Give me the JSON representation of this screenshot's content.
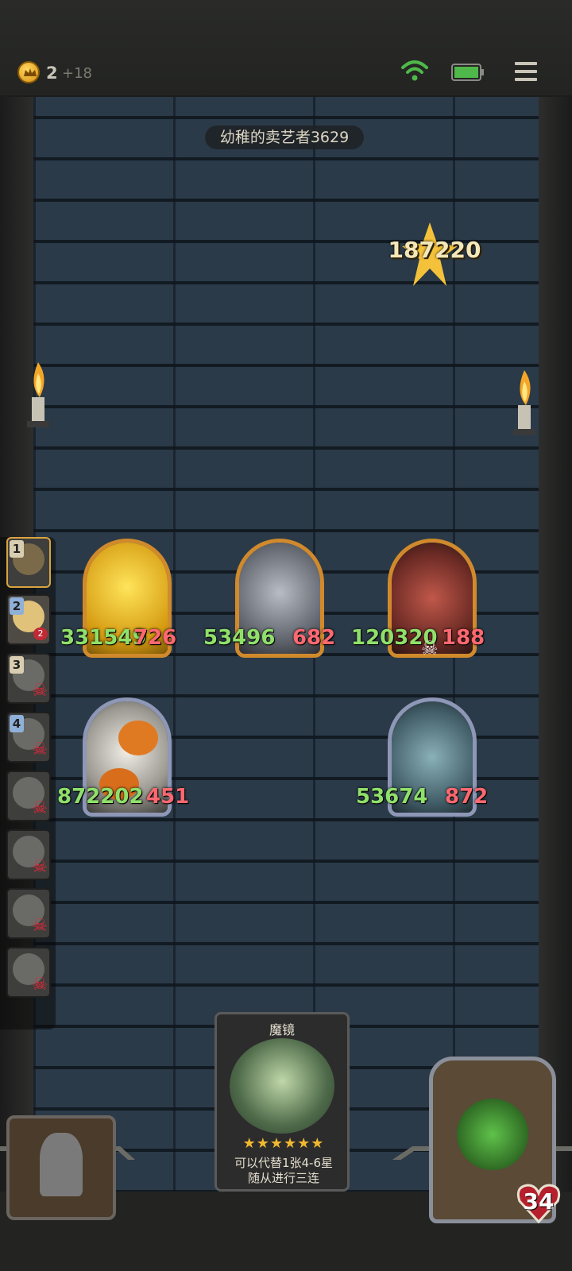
{
  "header": {
    "gold": "2",
    "gold_income": "+18"
  },
  "status": {
    "wifi_icon": "wifi-icon",
    "battery_icon": "battery-icon",
    "menu_icon": "menu-icon"
  },
  "board": {
    "player_name": "幼稚的卖艺者3629",
    "damage_popup": "187220"
  },
  "sidebar": {
    "slots": [
      {
        "rank": "1"
      },
      {
        "rank": "2",
        "badge": "2"
      },
      {
        "rank": "3"
      },
      {
        "rank": "4"
      }
    ]
  },
  "minions": [
    {
      "atk": "331549",
      "hp": "726"
    },
    {
      "atk": "53496",
      "hp": "682"
    },
    {
      "atk": "120320",
      "hp": "188"
    },
    {
      "atk": "872202",
      "hp": "451"
    },
    {
      "atk": "53674",
      "hp": "872"
    }
  ],
  "hand_card": {
    "title": "魔镜",
    "stars": "★★★★★★",
    "desc_line1": "可以代替1张4-6星",
    "desc_line2": "随从进行三连"
  },
  "hero": {
    "health": "34"
  },
  "colors": {
    "attack": "#8fe06a",
    "health": "#ff6870",
    "gold_frame": "#d08a2c",
    "silver_frame": "#8e97b6",
    "wall": "#2b3a48"
  }
}
